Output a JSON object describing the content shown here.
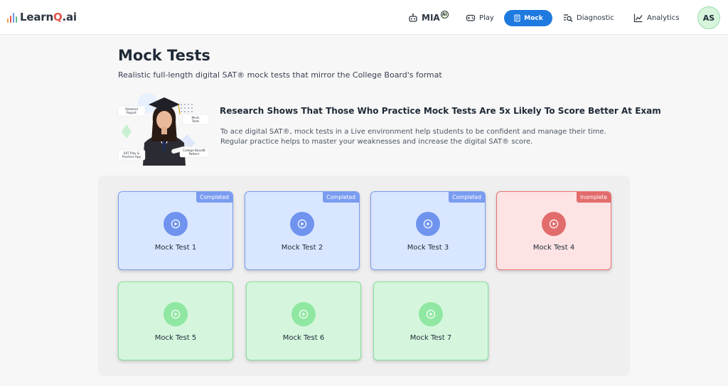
{
  "header": {
    "logo": {
      "prefix": "Learn",
      "accent": "Q",
      "suffix": ".ai"
    },
    "nav": {
      "mia_label": "MIA",
      "mia_badge": "AI",
      "play_label": "Play",
      "mock_label": "Mock",
      "diagnostic_label": "Diagnostic",
      "analytics_label": "Analytics"
    },
    "avatar_initials": "AS"
  },
  "page": {
    "title": "Mock Tests",
    "subtitle": "Realistic full-length digital SAT® mock tests that mirror the College Board's format"
  },
  "hero": {
    "heading": "Research Shows That Those Who Practice Mock Tests Are 5x Likely To Score Better At Exam",
    "line1": "To ace digital SAT®, mock tests in a Live environment help students to be confident and manage their time.",
    "line2": "Regular practice helps to master your weaknesses and increase the digital SAT® score.",
    "tags": {
      "detailed_report": [
        "Detailed",
        "Report"
      ],
      "mock_tests": [
        "Mock",
        "Tests"
      ],
      "sat_play": [
        "SAT Play &",
        "Practice App"
      ],
      "college_board": [
        "College Boardß",
        "Pattern"
      ]
    }
  },
  "tests": [
    {
      "label": "Mock Test 1",
      "status": "Completed",
      "variant": "blue"
    },
    {
      "label": "Mock Test 2",
      "status": "Completed",
      "variant": "blue"
    },
    {
      "label": "Mock Test 3",
      "status": "Completed",
      "variant": "blue"
    },
    {
      "label": "Mock Test 4",
      "status": "Inomplete",
      "variant": "red"
    },
    {
      "label": "Mock Test 5",
      "status": "",
      "variant": "green"
    },
    {
      "label": "Mock Test 6",
      "status": "",
      "variant": "green"
    },
    {
      "label": "Mock Test 7",
      "status": "",
      "variant": "green"
    }
  ],
  "colors": {
    "primary": "#1f7ae0",
    "completed": "#7a9cf0",
    "incomplete": "#e26c6c",
    "available": "#8fe7a2",
    "logo_accent": "#e5534b"
  }
}
